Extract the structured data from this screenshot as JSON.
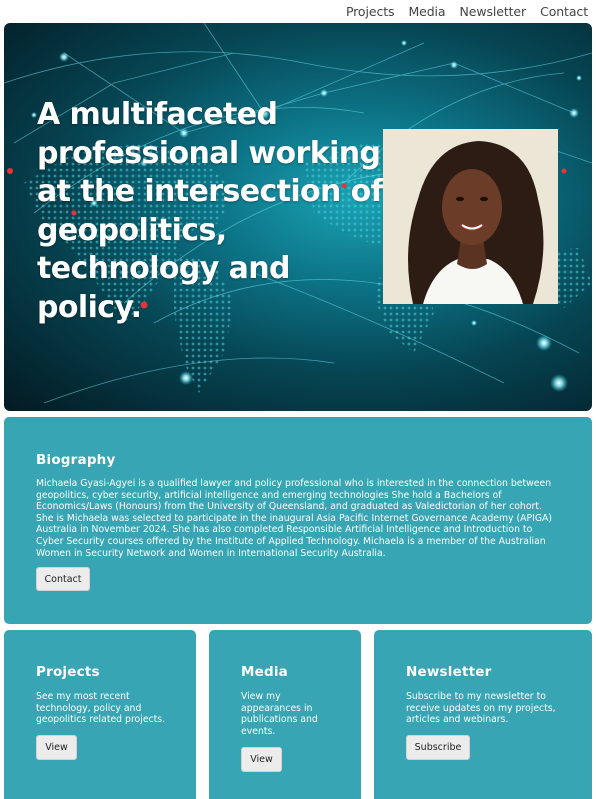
{
  "nav": {
    "items": [
      "Projects",
      "Media",
      "Newsletter",
      "Contact"
    ]
  },
  "hero": {
    "title": "A multifaceted professional working at the intersection of geopolitics, technology and policy.",
    "portrait_icon": "person-photo"
  },
  "biography": {
    "heading": "Biography",
    "text": "Michaela Gyasi-Agyei is a qualified lawyer and policy professional who is interested in the connection between geopolitics, cyber security, artificial intelligence and emerging technologies She hold a Bachelors of Economics/Laws (Honours) from the University of Queensland, and graduated as Valedictorian of her cohort. She is Michaela was selected to participate in the inaugural Asia Pacific Internet Governance Academy (APIGA) Australia in November 2024. She has also completed Responsible Artificial Intelligence and Introduction to Cyber Security courses offered by the Institute of Applied Technology. Michaela is a member of the Australian Women in Security Network and Women in International Security Australia.",
    "button": "Contact"
  },
  "cards": {
    "projects": {
      "heading": "Projects",
      "text": "See my most recent technology, policy and geopolitics related projects.",
      "button": "View"
    },
    "media": {
      "heading": "Media",
      "text": "View my appearances in publications and events.",
      "button": "View"
    },
    "newsletter": {
      "heading": "Newsletter",
      "text": "Subscribe to my newsletter to receive updates on my projects, articles and webinars.",
      "button": "Subscribe"
    }
  },
  "colors": {
    "card": "#37a5b3",
    "hero_dark": "#031a22",
    "hero_glow": "#1aa3b5",
    "button": "#ececec"
  }
}
